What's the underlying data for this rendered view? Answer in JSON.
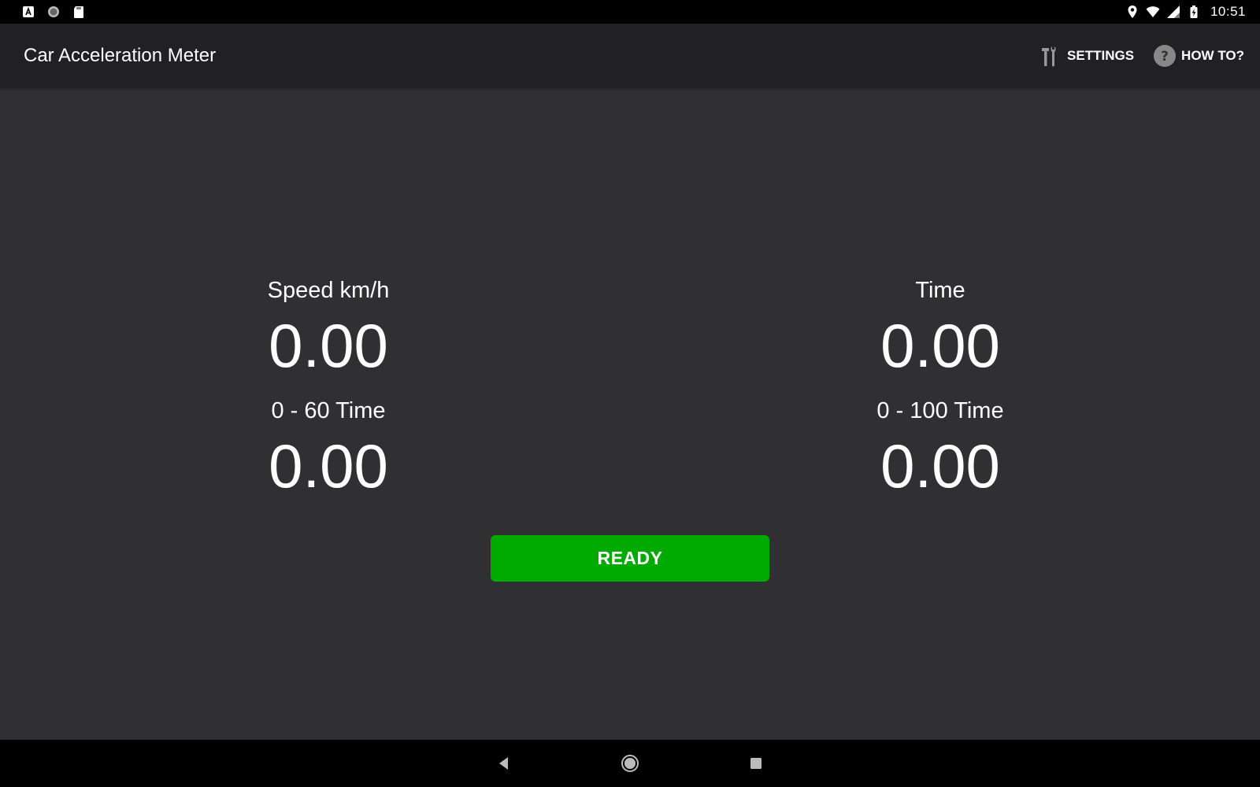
{
  "status_bar": {
    "time": "10:51",
    "left_icons": [
      "a-badge-icon",
      "circle-notification-icon",
      "sd-card-icon"
    ],
    "right_icons": [
      "location-icon",
      "wifi-icon",
      "signal-icon",
      "battery-charging-icon"
    ]
  },
  "app_bar": {
    "title": "Car Acceleration Meter",
    "actions": {
      "settings": {
        "label": "SETTINGS",
        "icon": "wrench-icon"
      },
      "howto": {
        "label": "HOW TO?",
        "icon": "help-icon"
      }
    }
  },
  "meters": {
    "speed": {
      "label": "Speed km/h",
      "value": "0.00"
    },
    "time": {
      "label": "Time",
      "value": "0.00"
    },
    "zero_60": {
      "label": "0 - 60 Time",
      "value": "0.00"
    },
    "zero_100": {
      "label": "0 - 100 Time",
      "value": "0.00"
    }
  },
  "ready_button": {
    "label": "READY",
    "color": "#00aa00"
  },
  "nav_bar": {
    "buttons": [
      "back-icon",
      "home-icon",
      "recents-icon"
    ]
  },
  "colors": {
    "background": "#303033",
    "app_bar": "#212123",
    "status_bar": "#000000",
    "accent": "#00aa00"
  }
}
